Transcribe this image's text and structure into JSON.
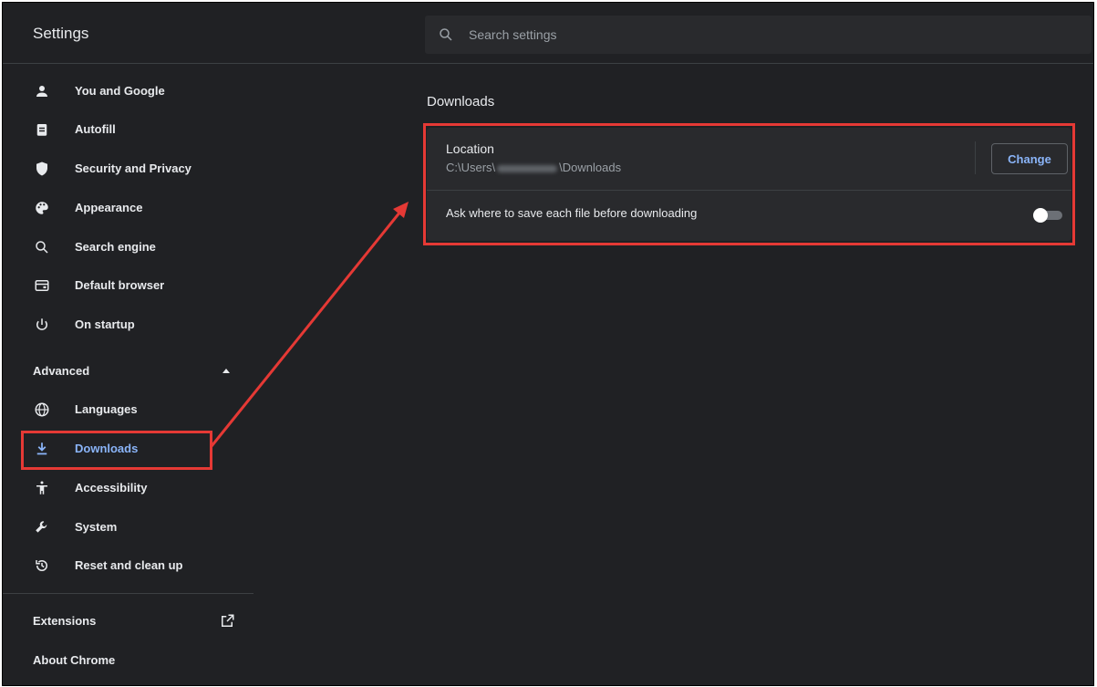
{
  "app": {
    "title": "Settings"
  },
  "search": {
    "placeholder": "Search settings"
  },
  "sidebar": {
    "items": [
      {
        "label": "You and Google",
        "icon": "person-icon"
      },
      {
        "label": "Autofill",
        "icon": "clipboard-icon"
      },
      {
        "label": "Security and Privacy",
        "icon": "shield-icon"
      },
      {
        "label": "Appearance",
        "icon": "palette-icon"
      },
      {
        "label": "Search engine",
        "icon": "search-icon"
      },
      {
        "label": "Default browser",
        "icon": "browser-window-icon"
      },
      {
        "label": "On startup",
        "icon": "power-icon"
      }
    ],
    "advanced": {
      "label": "Advanced",
      "expanded": true,
      "items": [
        {
          "label": "Languages",
          "icon": "globe-icon"
        },
        {
          "label": "Downloads",
          "icon": "download-icon",
          "active": true
        },
        {
          "label": "Accessibility",
          "icon": "accessibility-icon"
        },
        {
          "label": "System",
          "icon": "wrench-icon"
        },
        {
          "label": "Reset and clean up",
          "icon": "history-icon"
        }
      ]
    },
    "extensions": {
      "label": "Extensions",
      "icon": "open-in-new-icon"
    },
    "about": {
      "label": "About Chrome"
    }
  },
  "main": {
    "section_title": "Downloads",
    "location": {
      "label": "Location",
      "path_prefix": "C:\\Users\\",
      "path_suffix": "\\Downloads",
      "button_label": "Change"
    },
    "ask_toggle": {
      "label": "Ask where to save each file before downloading",
      "enabled": false
    }
  },
  "colors": {
    "accent": "#8ab4f8",
    "annotation": "#e53935",
    "background": "#202124",
    "card": "#292a2d"
  }
}
